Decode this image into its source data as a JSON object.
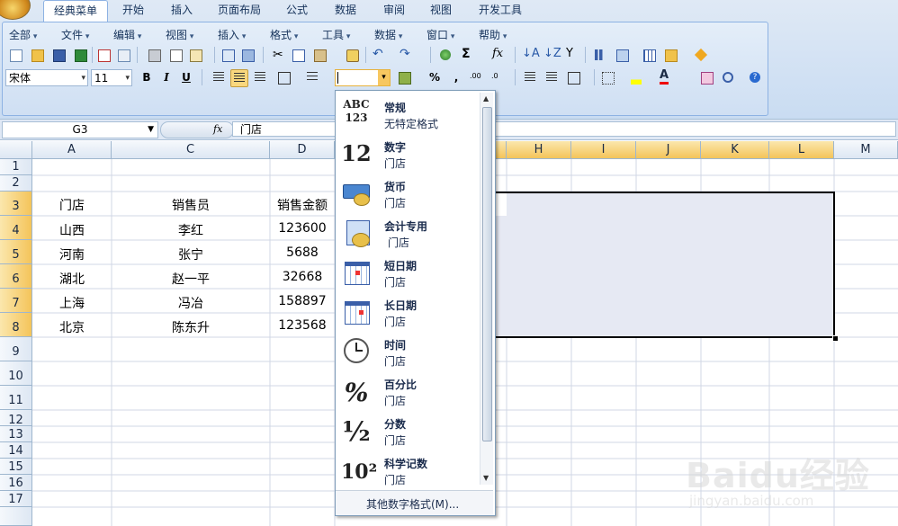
{
  "tabs": [
    "经典菜单",
    "开始",
    "插入",
    "页面布局",
    "公式",
    "数据",
    "审阅",
    "视图",
    "开发工具"
  ],
  "menus": [
    "全部",
    "文件",
    "编辑",
    "视图",
    "插入",
    "格式",
    "工具",
    "数据",
    "窗口",
    "帮助"
  ],
  "font": {
    "name": "宋体",
    "size": "11"
  },
  "format_buttons": {
    "bold": "B",
    "italic": "I",
    "underline": "U"
  },
  "number_format_value": "",
  "percent_symbol": "%",
  "comma_symbol": ",",
  "formula_bar": {
    "name_box": "G3",
    "fx_label": "fx",
    "content": "门店"
  },
  "columns": [
    {
      "label": "A"
    },
    {
      "label": "C"
    },
    {
      "label": "D"
    },
    {
      "label": "H"
    },
    {
      "label": "I"
    },
    {
      "label": "J"
    },
    {
      "label": "K"
    },
    {
      "label": "L"
    },
    {
      "label": "M"
    }
  ],
  "rows": [
    "1",
    "2",
    "3",
    "4",
    "5",
    "6",
    "7",
    "8",
    "9",
    "10",
    "11",
    "12",
    "13",
    "14",
    "15",
    "16",
    "17"
  ],
  "table": [
    {
      "a": "门店",
      "c": "销售员",
      "d": "销售金额"
    },
    {
      "a": "山西",
      "c": "李红",
      "d": "123600"
    },
    {
      "a": "河南",
      "c": "张宁",
      "d": "5688"
    },
    {
      "a": "湖北",
      "c": "赵一平",
      "d": "32668"
    },
    {
      "a": "上海",
      "c": "冯冶",
      "d": "158897"
    },
    {
      "a": "北京",
      "c": "陈东升",
      "d": "123568"
    }
  ],
  "dropdown": {
    "items": [
      {
        "title": "常规",
        "sub": "无特定格式",
        "icon": "general-icon",
        "glyph": "ABC 123"
      },
      {
        "title": "数字",
        "sub": "门店",
        "icon": "number-icon",
        "glyph": "12"
      },
      {
        "title": "货币",
        "sub": "门店",
        "icon": "currency-icon",
        "glyph": ""
      },
      {
        "title": "会计专用",
        "sub": "门店",
        "icon": "accounting-icon",
        "glyph": ""
      },
      {
        "title": "短日期",
        "sub": "门店",
        "icon": "calendar-icon",
        "glyph": ""
      },
      {
        "title": "长日期",
        "sub": "门店",
        "icon": "calendar-icon",
        "glyph": ""
      },
      {
        "title": "时间",
        "sub": "门店",
        "icon": "clock-icon",
        "glyph": ""
      },
      {
        "title": "百分比",
        "sub": "门店",
        "icon": "percent-icon",
        "glyph": "%"
      },
      {
        "title": "分数",
        "sub": "门店",
        "icon": "fraction-icon",
        "glyph": "½"
      },
      {
        "title": "科学记数",
        "sub": "门店",
        "icon": "scientific-icon",
        "glyph": "10²"
      }
    ],
    "footer": "其他数字格式(M)..."
  },
  "watermark": {
    "brand": "Baidu经验",
    "url": "jingyan.baidu.com"
  },
  "colors": {
    "accent": "#15325a",
    "selected_header": "#f4c45a",
    "selection_fill": "#e6e9f3"
  }
}
